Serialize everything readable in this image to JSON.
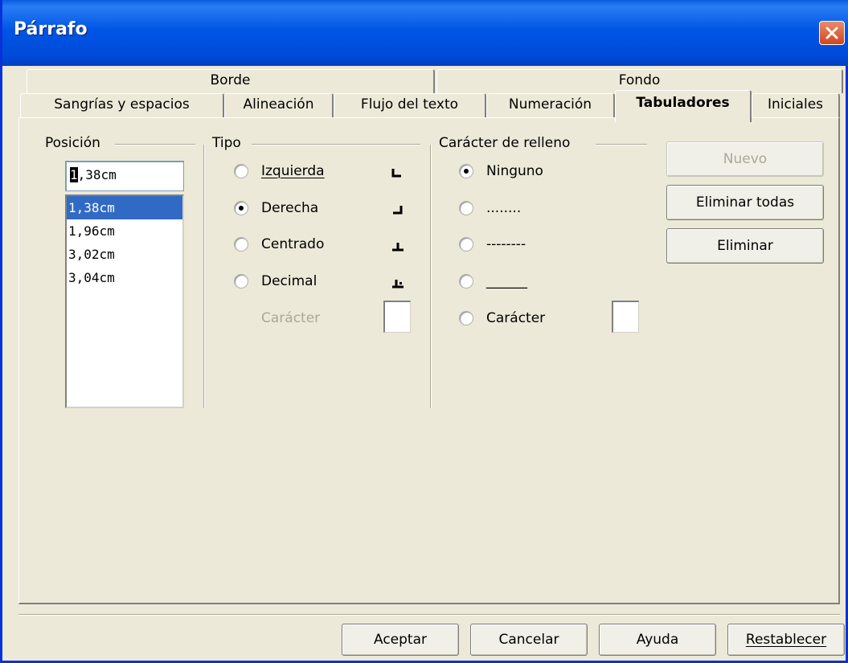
{
  "window": {
    "title": "Párrafo"
  },
  "tabs": {
    "row1": [
      {
        "label": "Borde"
      },
      {
        "label": "Fondo"
      }
    ],
    "row2": [
      {
        "label": "Sangrías y espacios"
      },
      {
        "label": "Alineación"
      },
      {
        "label": "Flujo del texto"
      },
      {
        "label": "Numeración"
      },
      {
        "label": "Tabuladores",
        "active": true
      },
      {
        "label": "Iniciales"
      }
    ]
  },
  "position": {
    "group_label": "Posición",
    "input_value": ",38cm",
    "input_leading": "1",
    "items": [
      "1,38cm",
      "1,96cm",
      "3,02cm",
      "3,04cm"
    ],
    "selected_index": 0
  },
  "tipo": {
    "group_label": "Tipo",
    "options": [
      {
        "label": "Izquierda",
        "checked": false,
        "glyph": "tab-left-icon"
      },
      {
        "label": "Derecha",
        "checked": true,
        "glyph": "tab-right-icon"
      },
      {
        "label": "Centrado",
        "checked": false,
        "glyph": "tab-center-icon"
      },
      {
        "label": "Decimal",
        "checked": false,
        "glyph": "tab-decimal-icon"
      }
    ],
    "caracter_label": "Carácter",
    "caracter_value": ""
  },
  "relleno": {
    "group_label": "Carácter de relleno",
    "options": [
      {
        "label": "Ninguno",
        "checked": true
      },
      {
        "label": "........",
        "checked": false
      },
      {
        "label": "--------",
        "checked": false
      },
      {
        "label": "______",
        "checked": false
      },
      {
        "label": "Carácter",
        "checked": false
      }
    ],
    "caracter_value": ""
  },
  "side_buttons": {
    "nuevo": "Nuevo",
    "eliminar_todas": "Eliminar todas",
    "eliminar": "Eliminar"
  },
  "footer": {
    "aceptar": "Aceptar",
    "cancelar": "Cancelar",
    "ayuda": "Ayuda",
    "restablecer": "Restablecer"
  },
  "colors": {
    "titlebar": "#0055e5",
    "dialog_bg": "#ece9d8",
    "selection": "#316ac5",
    "close_button": "#d4451c"
  }
}
